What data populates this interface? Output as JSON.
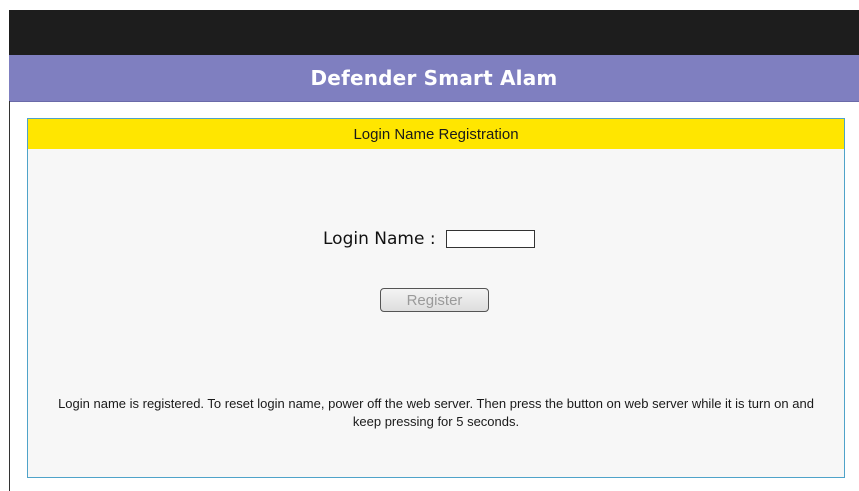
{
  "header": {
    "title": "Defender Smart Alam"
  },
  "panel": {
    "heading": "Login Name Registration",
    "login_label": "Login Name :",
    "login_value": "",
    "register_label": "Register",
    "notice": "Login name is registered. To reset login name, power off the web server. Then press the button on web server while it is turn on and keep pressing for 5 seconds."
  },
  "colors": {
    "top_bar": "#1d1d1d",
    "title_bar": "#7f7fc0",
    "panel_header": "#ffe600",
    "panel_border": "#4fa3c9",
    "panel_background": "#f7f7f7"
  }
}
